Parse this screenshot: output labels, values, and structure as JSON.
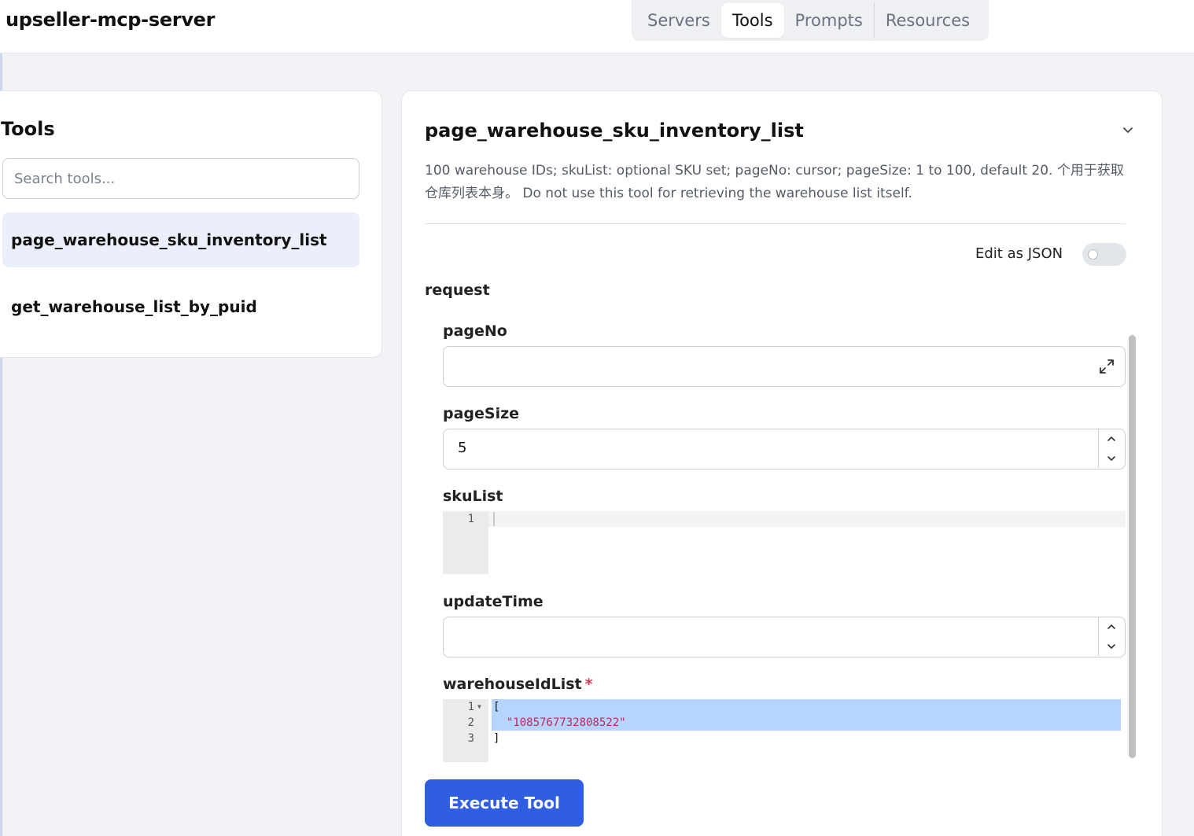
{
  "app": {
    "title": "upseller-mcp-server"
  },
  "nav": {
    "tabs": [
      {
        "label": "Servers",
        "active": false
      },
      {
        "label": "Tools",
        "active": true
      },
      {
        "label": "Prompts",
        "active": false
      },
      {
        "label": "Resources",
        "active": false
      }
    ]
  },
  "tools_panel": {
    "heading": "Tools",
    "search_placeholder": "Search tools...",
    "items": [
      {
        "label": "page_warehouse_sku_inventory_list",
        "selected": true
      },
      {
        "label": "get_warehouse_list_by_puid",
        "selected": false
      }
    ]
  },
  "detail": {
    "title": "page_warehouse_sku_inventory_list",
    "description": "100 warehouse IDs; skuList: optional SKU set; pageNo: cursor; pageSize: 1 to 100, default 20. 个用于获取仓库列表本身。 Do not use this tool for retrieving the warehouse list itself.",
    "edit_as_json_label": "Edit as JSON",
    "edit_as_json_enabled": false,
    "request_label": "request",
    "fields": {
      "pageNo": {
        "label": "pageNo",
        "value": ""
      },
      "pageSize": {
        "label": "pageSize",
        "value": "5"
      },
      "skuList": {
        "label": "skuList",
        "lines": [
          {
            "num": "1",
            "text": ""
          }
        ]
      },
      "updateTime": {
        "label": "updateTime",
        "value": ""
      },
      "warehouseIdList": {
        "label": "warehouseIdList",
        "required_mark": "*",
        "lines": [
          {
            "num": "1",
            "text": "["
          },
          {
            "num": "2",
            "text": "  \"1085767732808522\""
          },
          {
            "num": "3",
            "text": "]"
          }
        ]
      }
    },
    "execute_label": "Execute Tool"
  },
  "colors": {
    "accent": "#2f5fe0",
    "selected_item_bg": "#ebeffb",
    "required_star": "#d6364f",
    "json_string": "#c4245b",
    "selection": "#b5d5ff"
  },
  "icons": {
    "collapse": "chevron-down-icon",
    "expand": "expand-arrows-icon",
    "stepper_up": "chevron-up-icon",
    "stepper_down": "chevron-down-icon",
    "fold": "fold-triangle-icon"
  }
}
